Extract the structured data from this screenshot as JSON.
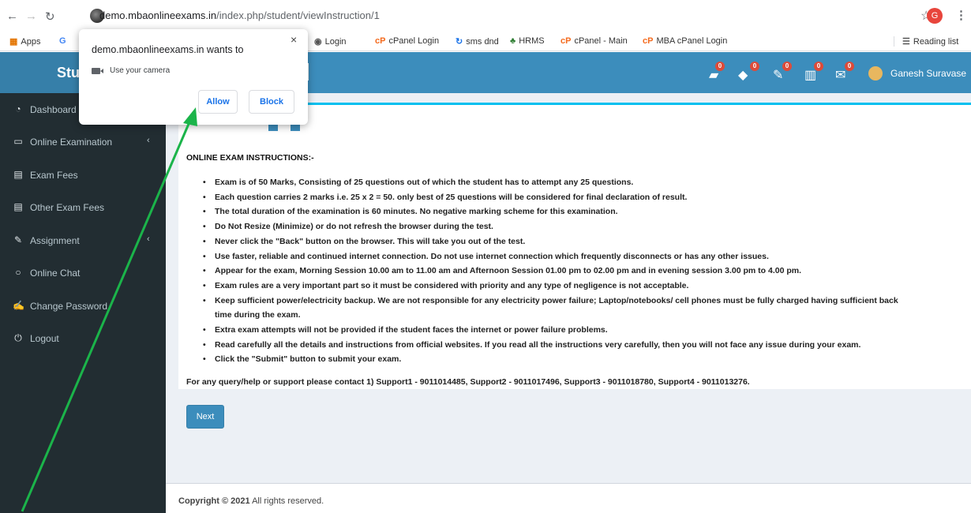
{
  "browser": {
    "url_host": "demo.mbaonlineexams.in",
    "url_path": "/index.php/student/viewInstruction/1",
    "profile_initial": "G",
    "bookmarks": [
      {
        "icon": "apps-grid-icon",
        "label": "Apps"
      },
      {
        "icon": "google-icon",
        "label": "G"
      },
      {
        "icon": "globe-icon",
        "label": "Login"
      },
      {
        "icon": "cpanel-icon",
        "label": "cPanel Login"
      },
      {
        "icon": "sms-icon",
        "label": "sms dnd"
      },
      {
        "icon": "tree-icon",
        "label": "HRMS"
      },
      {
        "icon": "cpanel-icon",
        "label": "cPanel - Main"
      },
      {
        "icon": "cpanel-icon",
        "label": "MBA cPanel Login"
      }
    ],
    "reading_list_label": "Reading list"
  },
  "permission_popup": {
    "title": "demo.mbaonlineexams.in wants to",
    "request": "Use your camera",
    "allow_label": "Allow",
    "block_label": "Block",
    "close_glyph": "×"
  },
  "header": {
    "brand_partial": "Stu",
    "user_name": "Ganesh Suravase",
    "notification_icons": [
      {
        "name": "book-icon",
        "badge": "0"
      },
      {
        "name": "graduation-cap-icon",
        "badge": "0"
      },
      {
        "name": "pencil-icon",
        "badge": "0"
      },
      {
        "name": "building-icon",
        "badge": "0"
      },
      {
        "name": "envelope-icon",
        "badge": "0"
      }
    ]
  },
  "sidebar": {
    "items": [
      {
        "icon": "dashboard-icon",
        "label": "Dashboard",
        "has_caret": false
      },
      {
        "icon": "laptop-icon",
        "label": "Online Examination",
        "has_caret": true
      },
      {
        "icon": "file-icon",
        "label": "Exam Fees",
        "has_caret": false
      },
      {
        "icon": "file-icon",
        "label": "Other Exam Fees",
        "has_caret": false
      },
      {
        "icon": "pencil-icon",
        "label": "Assignment",
        "has_caret": true
      },
      {
        "icon": "chat-icon",
        "label": "Online Chat",
        "has_caret": false
      },
      {
        "icon": "edit-icon",
        "label": "Change Password",
        "has_caret": false
      },
      {
        "icon": "power-icon",
        "label": "Logout",
        "has_caret": false
      }
    ]
  },
  "main": {
    "heading": "ONLINE EXAM INSTRUCTIONS:-",
    "instructions": [
      "Exam is of 50 Marks, Consisting of 25 questions out of which the student has to attempt any 25 questions.",
      "Each question carries 2 marks i.e. 25 x 2 = 50. only best of 25 questions will be considered for final declaration of result.",
      "The total duration of the examination is 60 minutes. No negative marking scheme for this examination.",
      "Do Not Resize (Minimize) or do not refresh the browser during the test.",
      "Never click the \"Back\" button on the browser. This will take you out of the test.",
      "Use faster, reliable and continued internet connection. Do not use internet connection which frequently disconnects or has any other issues.",
      "Appear for the exam, Morning Session 10.00 am to 11.00 am and Afternoon Session 01.00 pm to 02.00 pm and in evening session 3.00 pm to 4.00 pm.",
      "Exam rules are a very important part so it must be considered with priority and any type of negligence is not acceptable.",
      " Keep sufficient power/electricity backup. We are not responsible for any electricity power failure; Laptop/notebooks/ cell phones must be fully charged having sufficient back",
      "time during the exam.",
      "Extra exam attempts will not be provided if the student faces the internet or power failure problems.",
      "Read carefully all the details and instructions from official websites. If you read all the instructions very carefully, then you will not face any issue during your exam.",
      "Click the \"Submit\" button to submit your exam."
    ],
    "contact": "For any query/help or support please contact 1) Support1 - 9011014485, Support2 - 9011017496, Support3 - 9011018780, Support4 - 9011013276.",
    "next_label": "Next"
  },
  "footer": {
    "copyright_bold": "Copyright © 2021",
    "copyright_rest": " All rights reserved."
  },
  "colors": {
    "header_blue": "#3c8dbc",
    "sidebar_dark": "#222d32",
    "annotation_arrow": "#1bb44a"
  }
}
